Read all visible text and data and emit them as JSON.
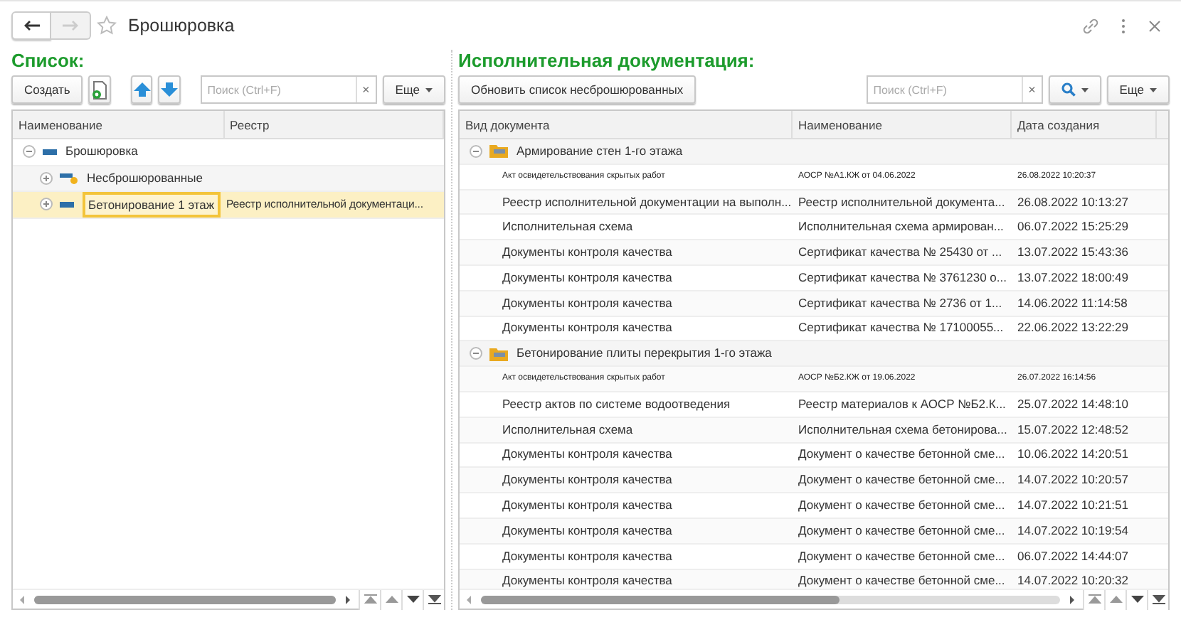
{
  "window": {
    "title": "Брошюровка",
    "back_disabled": false,
    "forward_disabled": true
  },
  "left": {
    "heading": "Список:",
    "create_button": "Создать",
    "search": {
      "placeholder": "Поиск (Ctrl+F)"
    },
    "clear": "×",
    "more_button": "Еще",
    "columns": [
      "Наименование",
      "Реестр"
    ],
    "tree": [
      {
        "name": "Брошюровка",
        "expanded": true,
        "selected": false,
        "children": [
          {
            "name": "Несброшюрованные",
            "kind": "unbound",
            "selected": false,
            "expanded": false
          },
          {
            "name": "Бетонирование 1 этаж",
            "registry": "Реестр исполнительной документаци...",
            "kind": "item",
            "selected": true,
            "expanded": false
          }
        ]
      }
    ]
  },
  "right": {
    "heading": "Исполнительная документация:",
    "refresh_button": "Обновить список несброшюрованных",
    "search": {
      "placeholder": "Поиск (Ctrl+F)"
    },
    "clear": "×",
    "more_button": "Еще",
    "columns": [
      "Вид документа",
      "Наименование",
      "Дата создания"
    ],
    "groups": [
      {
        "name": "Армирование стен 1-го этажа",
        "expanded": true,
        "rows": [
          {
            "kind": "act",
            "type": "Акт освидетельствования скрытых работ",
            "name": "АОСР №А1.КЖ от 04.06.2022",
            "date": "26.08.2022 10:20:37"
          },
          {
            "kind": "doc",
            "type": "Реестр исполнительной документации на выполн...",
            "name": "Реестр исполнительной документа...",
            "date": "26.08.2022 10:13:27"
          },
          {
            "kind": "doc",
            "type": "Исполнительная схема",
            "name": "Исполнительная схема армирован...",
            "date": "06.07.2022 15:25:29"
          },
          {
            "kind": "doc",
            "type": "Документы контроля качества",
            "name": "Сертификат качества № 25430 от ...",
            "date": "13.07.2022 15:43:36"
          },
          {
            "kind": "doc",
            "type": "Документы контроля качества",
            "name": "Сертификат качества № 3761230 о...",
            "date": "13.07.2022 18:00:49"
          },
          {
            "kind": "doc",
            "type": "Документы контроля качества",
            "name": "Сертификат качества № 2736 от 1...",
            "date": "14.06.2022 11:14:58"
          },
          {
            "kind": "doc",
            "type": "Документы контроля качества",
            "name": "Сертификат качества № 17100055...",
            "date": "22.06.2022 13:22:29"
          }
        ]
      },
      {
        "name": "Бетонирование плиты перекрытия 1-го этажа",
        "expanded": true,
        "rows": [
          {
            "kind": "act",
            "type": "Акт освидетельствования скрытых работ",
            "name": "АОСР №Б2.КЖ от 19.06.2022",
            "date": "26.07.2022 16:14:56"
          },
          {
            "kind": "doc",
            "type": "Реестр актов по системе водоотведения",
            "name": "Реестр материалов к АОСР №Б2.К...",
            "date": "25.07.2022 14:48:10"
          },
          {
            "kind": "doc",
            "type": "Исполнительная схема",
            "name": "Исполнительная схема бетонирова...",
            "date": "15.07.2022 12:48:52"
          },
          {
            "kind": "doc",
            "type": "Документы контроля качества",
            "name": "Документ о качестве бетонной сме...",
            "date": "10.06.2022 14:20:51"
          },
          {
            "kind": "doc",
            "type": "Документы контроля качества",
            "name": "Документ о качестве бетонной сме...",
            "date": "14.07.2022 10:20:57"
          },
          {
            "kind": "doc",
            "type": "Документы контроля качества",
            "name": "Документ о качестве бетонной сме...",
            "date": "14.07.2022 10:21:51"
          },
          {
            "kind": "doc",
            "type": "Документы контроля качества",
            "name": "Документ о качестве бетонной сме...",
            "date": "14.07.2022 10:19:54"
          },
          {
            "kind": "doc",
            "type": "Документы контроля качества",
            "name": "Документ о качестве бетонной сме...",
            "date": "06.07.2022 14:44:07"
          },
          {
            "kind": "doc",
            "type": "Документы контроля качества",
            "name": "Документ о качестве бетонной сме...",
            "date": "14.07.2022 10:20:32"
          }
        ]
      }
    ]
  }
}
